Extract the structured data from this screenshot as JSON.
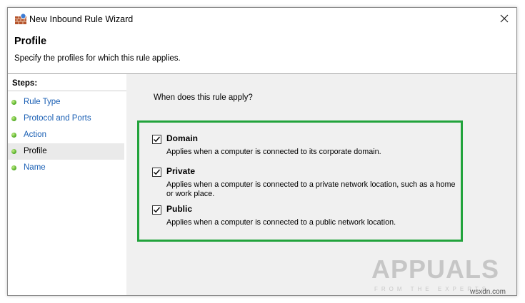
{
  "window": {
    "title": "New Inbound Rule Wizard"
  },
  "header": {
    "title": "Profile",
    "description": "Specify the profiles for which this rule applies."
  },
  "steps": {
    "heading": "Steps:",
    "items": [
      {
        "label": "Rule Type",
        "active": false
      },
      {
        "label": "Protocol and Ports",
        "active": false
      },
      {
        "label": "Action",
        "active": false
      },
      {
        "label": "Profile",
        "active": true
      },
      {
        "label": "Name",
        "active": false
      }
    ]
  },
  "content": {
    "question": "When does this rule apply?",
    "options": [
      {
        "label": "Domain",
        "checked": true,
        "description": "Applies when a computer is connected to its corporate domain."
      },
      {
        "label": "Private",
        "checked": true,
        "description": "Applies when a computer is connected to a private network location, such as a home or work place."
      },
      {
        "label": "Public",
        "checked": true,
        "description": "Applies when a computer is connected to a public network location."
      }
    ]
  },
  "watermark": {
    "text": "APPUALS",
    "tagline": "FROM THE EXPERTS"
  },
  "corner_text": "wsxdn.com",
  "colors": {
    "highlight_box": "#22a33c",
    "link": "#1a5fb4",
    "steps_bullet": "#4aa81e"
  },
  "icons": {
    "app": "firewall-wall-icon",
    "close": "close-icon",
    "step_bullet": "green-dot-icon",
    "check": "checkmark-icon"
  }
}
